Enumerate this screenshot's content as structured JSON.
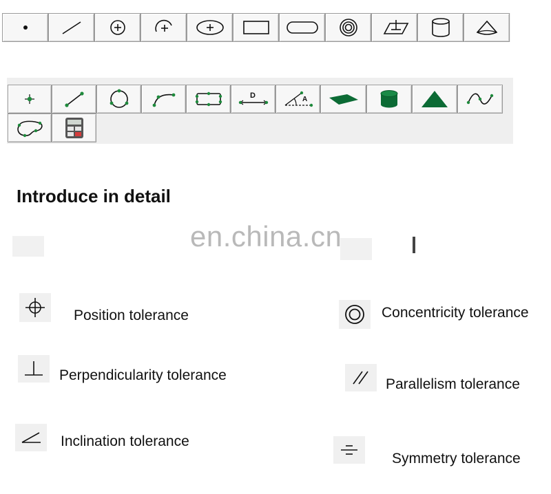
{
  "section": {
    "heading": "Introduce in detail"
  },
  "watermark": "en.china.cn",
  "toolbar1": {
    "buttons": [
      {
        "name": "point-icon"
      },
      {
        "name": "line-icon"
      },
      {
        "name": "circle-center-icon"
      },
      {
        "name": "arc-icon"
      },
      {
        "name": "ellipse-center-icon"
      },
      {
        "name": "rectangle-icon"
      },
      {
        "name": "slot-icon"
      },
      {
        "name": "concentric-circles-icon"
      },
      {
        "name": "plane-icon"
      },
      {
        "name": "cylinder-icon"
      },
      {
        "name": "cone-icon"
      }
    ]
  },
  "toolbar2": {
    "buttons": [
      {
        "name": "point-measure-icon"
      },
      {
        "name": "line-measure-icon"
      },
      {
        "name": "circle-measure-icon"
      },
      {
        "name": "arc-measure-icon"
      },
      {
        "name": "rectangle-measure-icon"
      },
      {
        "name": "distance-icon"
      },
      {
        "name": "angle-icon"
      },
      {
        "name": "plane-measure-icon"
      },
      {
        "name": "cylinder-measure-icon"
      },
      {
        "name": "cone-measure-icon"
      },
      {
        "name": "curve-icon"
      },
      {
        "name": "freeform-icon"
      },
      {
        "name": "calculator-icon"
      }
    ]
  },
  "tolerances": {
    "position": "Position tolerance",
    "concentricity": "Concentricity tolerance",
    "perpendicularity": "Perpendicularity tolerance",
    "parallelism": "Parallelism tolerance",
    "inclination": "Inclination tolerance",
    "symmetry": "Symmetry tolerance"
  },
  "colors": {
    "accent_green": "#0c6b35",
    "point_green": "#1e8a3c"
  }
}
